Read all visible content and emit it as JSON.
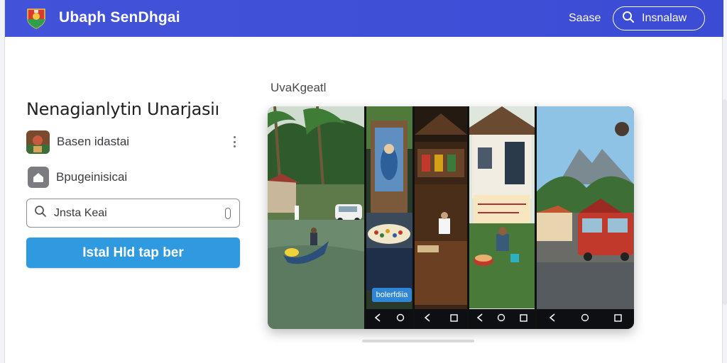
{
  "app": {
    "title": "Ubaph SenDhgai",
    "top_link": "Saase",
    "top_button": "Insnalaw"
  },
  "panel": {
    "title": "Nenagianlytin Unarjasiı",
    "items": [
      {
        "label": "Basen idastai"
      },
      {
        "label": "Bpugeinisicai"
      }
    ],
    "search": {
      "value": "Jnsta Keai"
    },
    "primary_button": "Istal Hld tap ber"
  },
  "gallery": {
    "caption": "UvaKgeatl",
    "screens": [
      {
        "name": "river-boat"
      },
      {
        "name": "shrine-market",
        "chip": "bolerfdiia"
      },
      {
        "name": "wooden-stall"
      },
      {
        "name": "village-vendor"
      },
      {
        "name": "mountain-street"
      }
    ]
  },
  "icons": [
    "app-logo-icon",
    "search-icon",
    "kebab-menu-icon",
    "house-icon",
    "back-icon",
    "home-icon",
    "recents-icon"
  ],
  "colors": {
    "topbar": "#4353d9",
    "primary_button": "#2f9ae0",
    "text": "#202124"
  }
}
